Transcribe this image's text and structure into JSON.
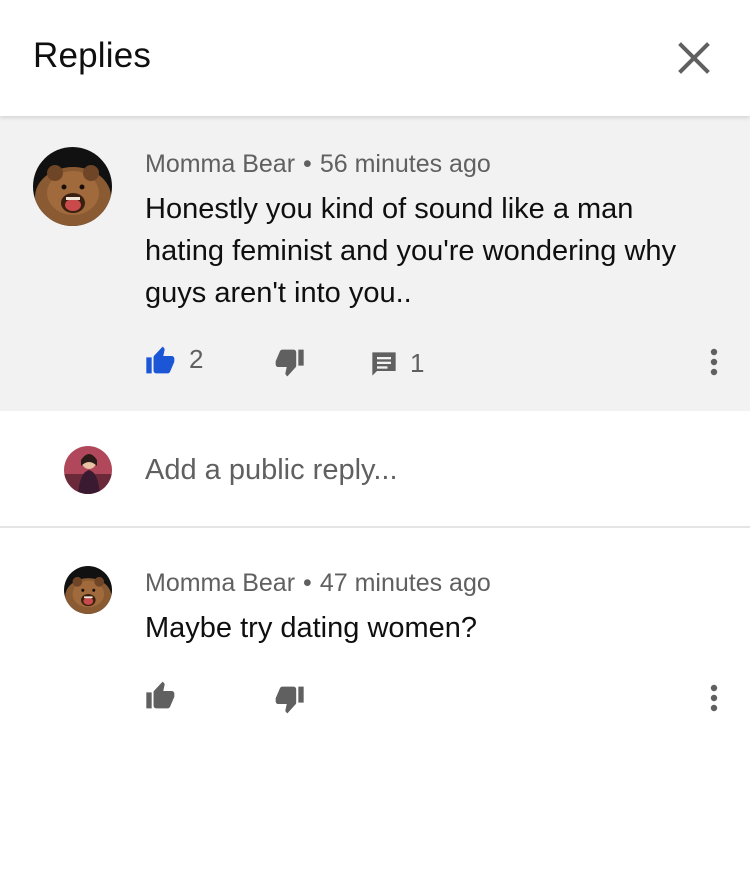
{
  "header": {
    "title": "Replies"
  },
  "parent_comment": {
    "author": "Momma Bear",
    "separator": "•",
    "time": "56 minutes ago",
    "text": "Honestly you kind of sound like a man hating feminist and you're wondering why guys aren't into you..",
    "likes": "2",
    "replies": "1",
    "liked": true,
    "like_color": "#1a56d6"
  },
  "reply_box": {
    "placeholder": "Add a public reply..."
  },
  "replies": [
    {
      "author": "Momma Bear",
      "separator": "•",
      "time": "47 minutes ago",
      "text": "Maybe try dating women?"
    }
  ],
  "icons": {
    "close": "close-icon",
    "like": "thumbs-up-icon",
    "dislike": "thumbs-down-icon",
    "reply": "comment-icon",
    "more": "more-vert-icon"
  },
  "colors": {
    "notification": "#e53935",
    "secondary_text": "#606060",
    "icon_gray": "#606060",
    "parent_bg": "#f2f2f2"
  }
}
